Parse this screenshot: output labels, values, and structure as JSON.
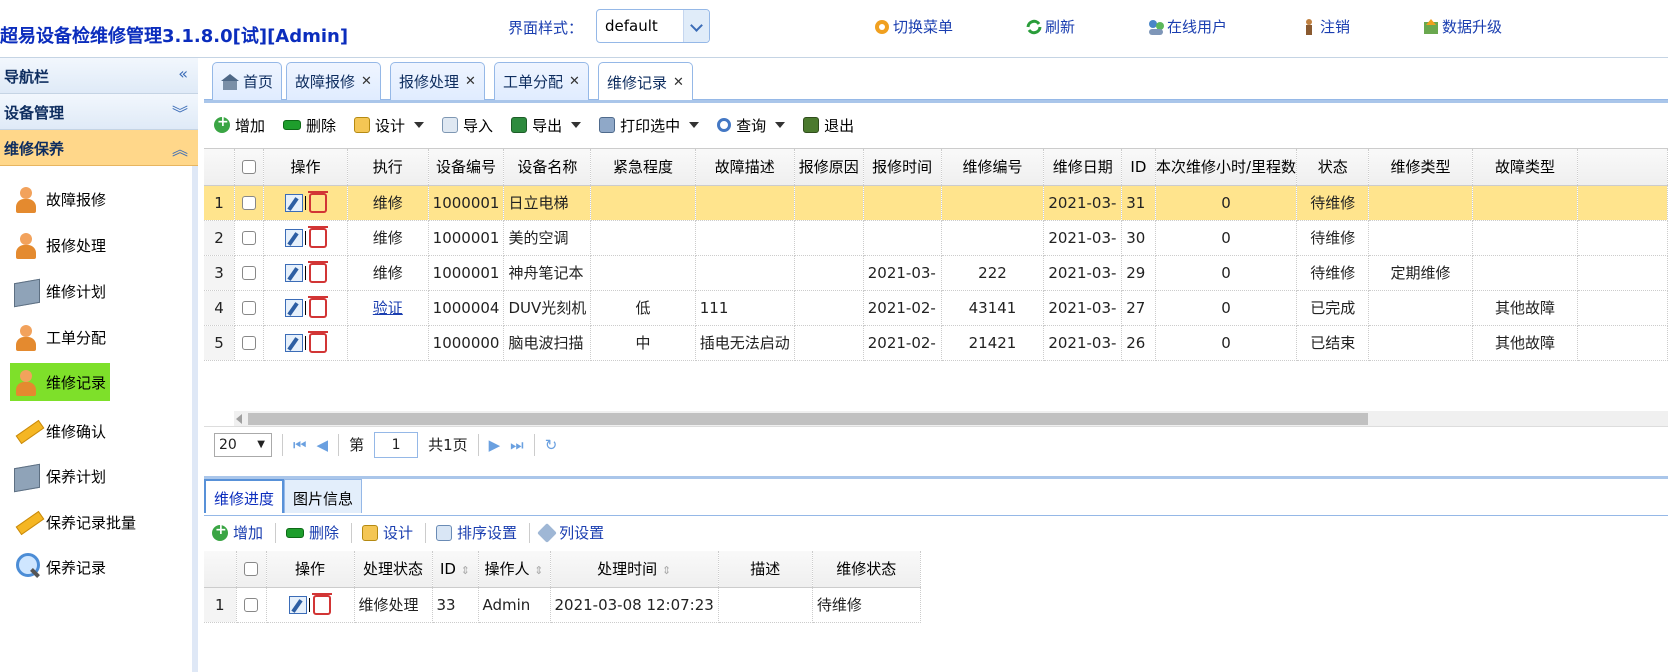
{
  "header": {
    "app_title": "超易设备检维修管理3.1.8.0[试][Admin]",
    "theme_label": "界面样式：",
    "theme_value": "default",
    "links": [
      {
        "label": "切换菜单",
        "icon": "switch-menu-icon"
      },
      {
        "label": "刷新",
        "icon": "refresh-icon"
      },
      {
        "label": "在线用户",
        "icon": "online-users-icon"
      },
      {
        "label": "注销",
        "icon": "logout-icon"
      },
      {
        "label": "数据升级",
        "icon": "data-upgrade-icon"
      }
    ]
  },
  "sidebar": {
    "nav_title": "导航栏",
    "section_equipment": "设备管理",
    "section_repair": "维修保养",
    "items": [
      {
        "label": "故障报修",
        "icon": "person-icon"
      },
      {
        "label": "报修处理",
        "icon": "person-icon"
      },
      {
        "label": "维修计划",
        "icon": "folder-icon"
      },
      {
        "label": "工单分配",
        "icon": "person-icon"
      },
      {
        "label": "维修记录",
        "icon": "person-icon"
      },
      {
        "label": "维修确认",
        "icon": "pencil-icon"
      },
      {
        "label": "保养计划",
        "icon": "folder-icon"
      },
      {
        "label": "保养记录批量",
        "icon": "pencil-icon"
      },
      {
        "label": "保养记录",
        "icon": "magnifier-icon"
      }
    ],
    "selected": "维修记录"
  },
  "tabs": [
    "首页",
    "故障报修",
    "报修处理",
    "工单分配",
    "维修记录"
  ],
  "active_tab": "维修记录",
  "toolbar": {
    "add": "增加",
    "delete": "删除",
    "design": "设计",
    "import": "导入",
    "export": "导出",
    "print": "打印选中",
    "query": "查询",
    "exit": "退出"
  },
  "grid": {
    "columns": [
      "操作",
      "执行",
      "设备编号",
      "设备名称",
      "紧急程度",
      "故障描述",
      "报修原因",
      "报修时间",
      "维修编号",
      "维修日期",
      "ID",
      "本次维修小时/里程数",
      "状态",
      "维修类型",
      "故障类型"
    ],
    "rows": [
      {
        "n": "1",
        "exec": "维修",
        "code": "1000001",
        "name": "日立电梯",
        "urgency": "",
        "desc": "",
        "reason": "",
        "rtime": "",
        "rno": "",
        "rdate": "2021-03-",
        "id": "31",
        "hours": "0",
        "status": "待维修",
        "rtype": "",
        "ftype": ""
      },
      {
        "n": "2",
        "exec": "维修",
        "code": "1000001",
        "name": "美的空调",
        "urgency": "",
        "desc": "",
        "reason": "",
        "rtime": "",
        "rno": "",
        "rdate": "2021-03-",
        "id": "30",
        "hours": "0",
        "status": "待维修",
        "rtype": "",
        "ftype": ""
      },
      {
        "n": "3",
        "exec": "维修",
        "code": "1000001",
        "name": "神舟笔记本",
        "urgency": "",
        "desc": "",
        "reason": "",
        "rtime": "2021-03-",
        "rno": "222",
        "rdate": "2021-03-",
        "id": "29",
        "hours": "0",
        "status": "待维修",
        "rtype": "定期维修",
        "ftype": ""
      },
      {
        "n": "4",
        "exec": "验证",
        "code": "1000004",
        "name": "DUV光刻机",
        "urgency": "低",
        "desc": "111",
        "reason": "",
        "rtime": "2021-02-",
        "rno": "43141",
        "rdate": "2021-03-",
        "id": "27",
        "hours": "0",
        "status": "已完成",
        "rtype": "",
        "ftype": "其他故障"
      },
      {
        "n": "5",
        "exec": "",
        "code": "1000000",
        "name": "脑电波扫描",
        "urgency": "中",
        "desc": "插电无法启动",
        "reason": "",
        "rtime": "2021-02-",
        "rno": "21421",
        "rdate": "2021-03-",
        "id": "26",
        "hours": "0",
        "status": "已结束",
        "rtype": "",
        "ftype": "其他故障"
      }
    ]
  },
  "pager": {
    "page_size": "20",
    "page_prefix": "第",
    "page_value": "1",
    "page_total": "共1页"
  },
  "bottom": {
    "tabs": [
      "维修进度",
      "图片信息"
    ],
    "toolbar": {
      "add": "增加",
      "delete": "删除",
      "design": "设计",
      "sort": "排序设置",
      "columns": "列设置"
    },
    "columns": [
      "操作",
      "处理状态",
      "ID",
      "操作人",
      "处理时间",
      "描述",
      "维修状态"
    ],
    "rows": [
      {
        "n": "1",
        "state": "维修处理",
        "id": "33",
        "user": "Admin",
        "time": "2021-03-08 12:07:23",
        "desc": "",
        "rstate": "待维修"
      }
    ]
  }
}
